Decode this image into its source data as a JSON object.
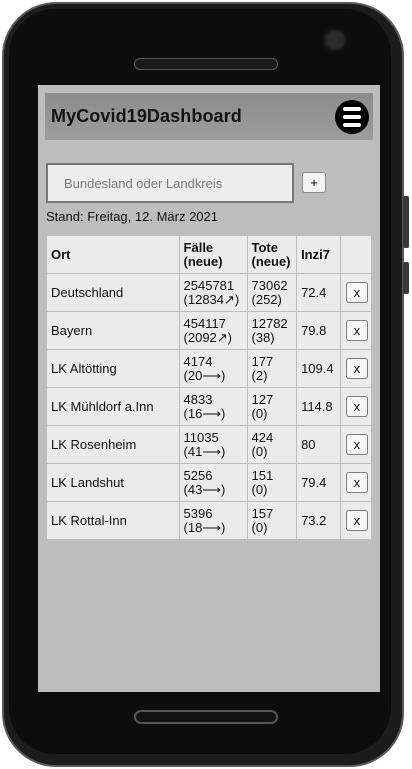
{
  "app": {
    "title": "MyCovid19Dashboard"
  },
  "icons": {
    "menu": "hamburger-menu-icon"
  },
  "search": {
    "placeholder": "Bundesland oder Landkreis",
    "value": "",
    "add_label": "+"
  },
  "status": {
    "stand": "Stand: Freitag, 12. März 2021"
  },
  "table": {
    "headers": {
      "ort": "Ort",
      "faelle_line1": "Fälle",
      "faelle_line2": "(neue)",
      "tote_line1": "Tote",
      "tote_line2": "(neue)",
      "inzi": "Inzi7"
    },
    "rows": [
      {
        "ort": "Deutschland",
        "faelle": "2545781",
        "faelle_neu": "(12834↗)",
        "tote": "73062",
        "tote_neu": "(252)",
        "inzi": "72.4",
        "remove_label": "x"
      },
      {
        "ort": "Bayern",
        "faelle": "454117",
        "faelle_neu": "(2092↗)",
        "tote": "12782",
        "tote_neu": "(38)",
        "inzi": "79.8",
        "remove_label": "x"
      },
      {
        "ort": "LK Altötting",
        "faelle": "4174",
        "faelle_neu": "(20⟶)",
        "tote": "177",
        "tote_neu": "(2)",
        "inzi": "109.4",
        "remove_label": "x"
      },
      {
        "ort": "LK Mühldorf a.Inn",
        "faelle": "4833",
        "faelle_neu": "(16⟶)",
        "tote": "127",
        "tote_neu": "(0)",
        "inzi": "114.8",
        "remove_label": "x"
      },
      {
        "ort": "LK Rosenheim",
        "faelle": "11035",
        "faelle_neu": "(41⟶)",
        "tote": "424",
        "tote_neu": "(0)",
        "inzi": "80",
        "remove_label": "x"
      },
      {
        "ort": "LK Landshut",
        "faelle": "5256",
        "faelle_neu": "(43⟶)",
        "tote": "151",
        "tote_neu": "(0)",
        "inzi": "79.4",
        "remove_label": "x"
      },
      {
        "ort": "LK Rottal-Inn",
        "faelle": "5396",
        "faelle_neu": "(18⟶)",
        "tote": "157",
        "tote_neu": "(0)",
        "inzi": "73.2",
        "remove_label": "x"
      }
    ]
  }
}
